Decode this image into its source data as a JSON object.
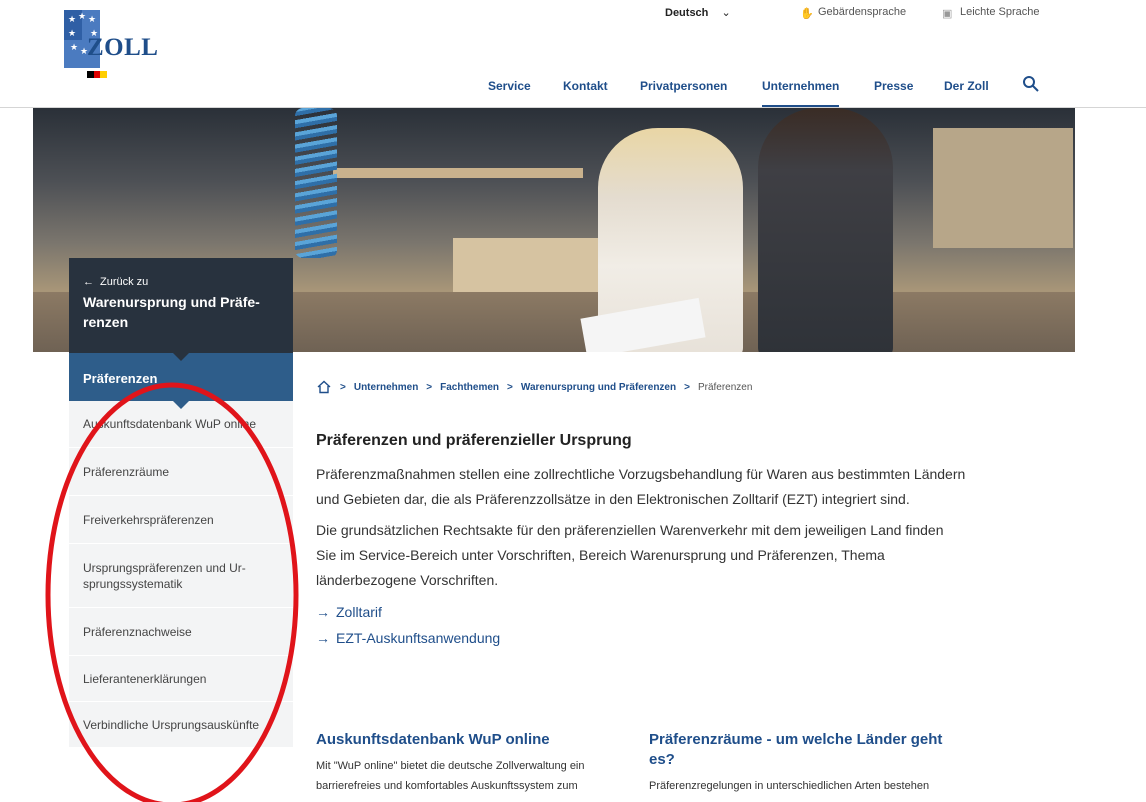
{
  "header": {
    "logo_text": "ZOLL",
    "language": "Deutsch",
    "links": {
      "sign_language": "Gebärdensprache",
      "easy_language": "Leichte Sprache"
    },
    "nav": [
      "Service",
      "Kontakt",
      "Privatpersonen",
      "Unternehmen",
      "Presse",
      "Der Zoll"
    ],
    "active_nav": "Unternehmen"
  },
  "sidebar": {
    "back_label": "Zurück zu",
    "back_title": "Warenursprung und Präfe-renzen",
    "current": "Präferenzen",
    "items": [
      "Auskunftsdatenbank WuP online",
      "Präferenzräume",
      "Freiverkehrspräferenzen",
      "Ursprungspräferenzen und Ur-sprungssystematik",
      "Präferenznachweise",
      "Lieferantenerklärungen",
      "Verbindliche Ursprungsauskünfte"
    ]
  },
  "breadcrumb": {
    "items": [
      "Unternehmen",
      "Fachthemen",
      "Warenursprung und Präferenzen"
    ],
    "current": "Präferenzen"
  },
  "content": {
    "title": "Präferenzen und präferenzieller Ursprung",
    "para1": "Präferenzmaßnahmen stellen eine zollrechtliche Vorzugsbehandlung für Waren aus bestimmten Ländern und Gebieten dar, die als Präferenzzollsätze in den Elektronischen Zolltarif (EZT) integriert sind.",
    "para2": "Die grundsätzlichen Rechtsakte für den präferenziellen Warenverkehr mit dem jeweiligen Land finden Sie im Service-Bereich unter Vorschriften, Bereich Warenursprung und Präferenzen, Thema länderbezogene Vorschriften.",
    "links": [
      "Zolltarif",
      "EZT-Auskunftsanwendung"
    ]
  },
  "teasers": [
    {
      "title": "Auskunftsdatenbank WuP online",
      "text": "Mit \"WuP online\" bietet die deutsche Zollverwaltung ein barrierefreies und komfortables Auskunftssystem zum"
    },
    {
      "title": "Präferenzräume - um welche Länder geht es?",
      "text": "Präferenzregelungen in unterschiedlichen Arten bestehen"
    }
  ],
  "colors": {
    "brand_blue": "#1f4e8a",
    "sidebar_dark": "#28323e",
    "sidebar_active": "#2e5d8a",
    "annotation_red": "#e0141a"
  }
}
